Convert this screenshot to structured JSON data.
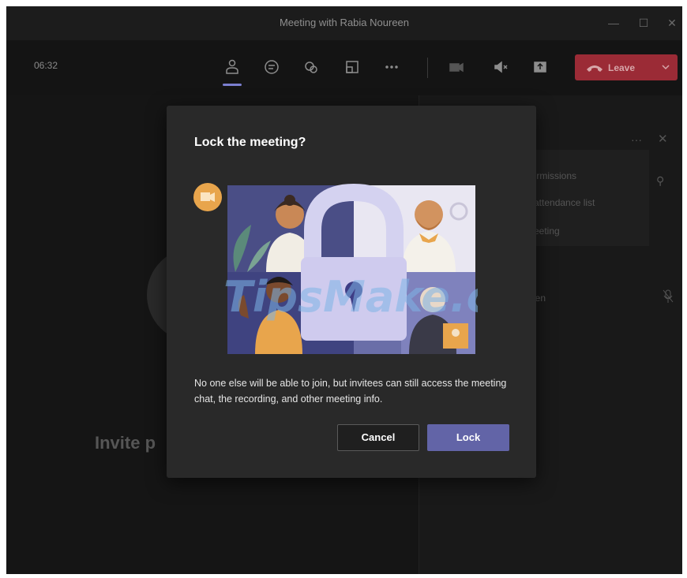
{
  "window": {
    "title": "Meeting with Rabia Noureen"
  },
  "toolbar": {
    "timer": "06:32",
    "icons": [
      "people-icon",
      "chat-icon",
      "reactions-icon",
      "breakout-rooms-icon",
      "more-icon",
      "camera-off-icon",
      "mute-icon",
      "share-icon"
    ],
    "leave_label": "Leave"
  },
  "stage": {
    "invite_text": "Invite p"
  },
  "panel": {
    "menu_items": [
      "permissions",
      "d attendance list",
      "meeting"
    ],
    "participant_partial": "een"
  },
  "dialog": {
    "title": "Lock the meeting?",
    "body": "No one else will be able to join, but invitees can still access the meeting chat, the recording, and other meeting info.",
    "cancel_label": "Cancel",
    "lock_label": "Lock",
    "watermark": "TipsMake.com"
  },
  "colors": {
    "accent": "#6264a7",
    "leave": "#9b2b36",
    "background": "#141414",
    "dialog": "#292929"
  }
}
